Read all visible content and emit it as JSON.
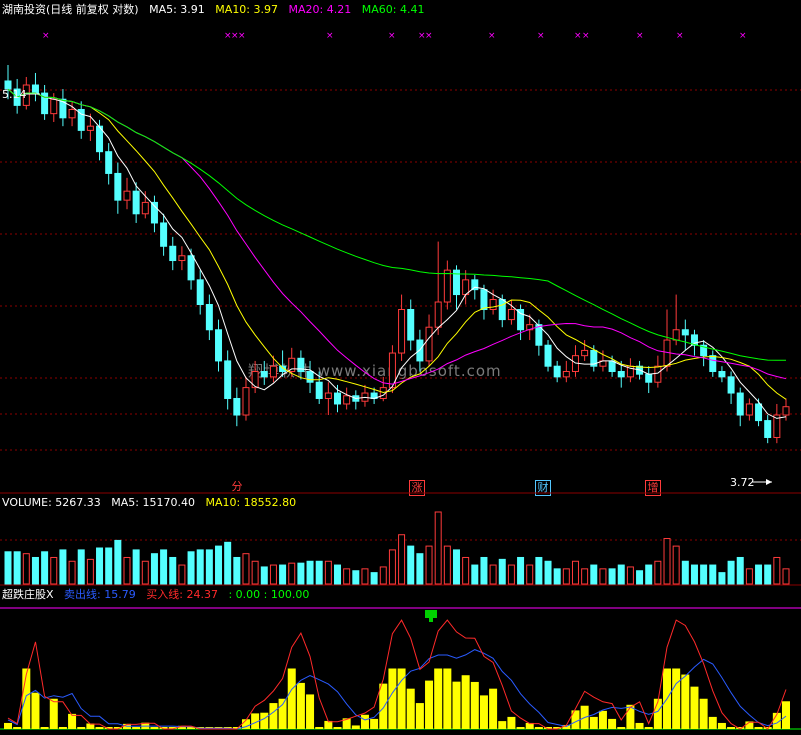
{
  "main_header": {
    "title": "湖南投资(日线 前复权 对数)",
    "ma5": "MA5: 3.91",
    "ma10": "MA10: 3.97",
    "ma20": "MA20: 4.21",
    "ma60": "MA60: 4.41"
  },
  "price_marks": {
    "high_label": "5.14",
    "low_label": "3.72"
  },
  "event_badges": [
    {
      "label": "分",
      "color": "#ff3b3b",
      "x": 236
    },
    {
      "label": "涨",
      "color": "#ff3b3b",
      "x": 409
    },
    {
      "label": "财",
      "color": "#54c7ff",
      "x": 535
    },
    {
      "label": "增",
      "color": "#ff3b3b",
      "x": 645
    }
  ],
  "volume_header": {
    "volume": "VOLUME: 5267.33",
    "ma5": "MA5: 15170.40",
    "ma10": "MA10: 18552.80"
  },
  "indicator_header": {
    "name": "超跌庄股X",
    "sell_line": "卖出线: 15.79",
    "buy_line": "买入线: 24.37",
    "range": ": 0.00 : 100.00"
  },
  "watermark": "翔博软件 www.xiangbosoft.com",
  "colors": {
    "up": "#ff3b3b",
    "down": "#54ffff",
    "ma5": "#ffffff",
    "ma10": "#ffff00",
    "ma20": "#ff00ff",
    "ma60": "#00ff00",
    "grid": "#8b0000",
    "sell_line": "#2a5bff",
    "buy_line": "#ff2a2a",
    "bar_yellow": "#ffff00"
  },
  "chart_data": {
    "type": "candlestick",
    "scale": "log",
    "ylim": [
      3.5,
      5.4
    ],
    "indicator_ylim": [
      0,
      100
    ],
    "candles": [
      [
        5.14,
        5.1,
        5.22,
        5.05
      ],
      [
        5.1,
        5.02,
        5.15,
        4.98
      ],
      [
        5.02,
        5.12,
        5.16,
        5.0
      ],
      [
        5.12,
        5.08,
        5.18,
        5.04
      ],
      [
        5.08,
        4.98,
        5.12,
        4.95
      ],
      [
        4.98,
        5.05,
        5.08,
        4.94
      ],
      [
        5.05,
        4.96,
        5.1,
        4.92
      ],
      [
        4.96,
        5.0,
        5.04,
        4.92
      ],
      [
        5.0,
        4.9,
        5.04,
        4.86
      ],
      [
        4.9,
        4.92,
        4.98,
        4.85
      ],
      [
        4.92,
        4.8,
        4.95,
        4.76
      ],
      [
        4.8,
        4.7,
        4.84,
        4.65
      ],
      [
        4.7,
        4.58,
        4.75,
        4.52
      ],
      [
        4.58,
        4.62,
        4.68,
        4.54
      ],
      [
        4.62,
        4.52,
        4.66,
        4.48
      ],
      [
        4.52,
        4.57,
        4.62,
        4.5
      ],
      [
        4.57,
        4.48,
        4.6,
        4.44
      ],
      [
        4.48,
        4.38,
        4.52,
        4.34
      ],
      [
        4.38,
        4.32,
        4.42,
        4.28
      ],
      [
        4.32,
        4.34,
        4.38,
        4.28
      ],
      [
        4.34,
        4.24,
        4.37,
        4.2
      ],
      [
        4.24,
        4.14,
        4.28,
        4.1
      ],
      [
        4.14,
        4.04,
        4.18,
        4.0
      ],
      [
        4.04,
        3.92,
        4.08,
        3.88
      ],
      [
        3.92,
        3.78,
        3.96,
        3.74
      ],
      [
        3.78,
        3.72,
        3.82,
        3.68
      ],
      [
        3.72,
        3.82,
        3.86,
        3.7
      ],
      [
        3.82,
        3.88,
        3.92,
        3.8
      ],
      [
        3.88,
        3.86,
        3.92,
        3.83
      ],
      [
        3.86,
        3.9,
        3.94,
        3.84
      ],
      [
        3.9,
        3.88,
        3.96,
        3.86
      ],
      [
        3.88,
        3.93,
        3.97,
        3.86
      ],
      [
        3.93,
        3.88,
        3.96,
        3.85
      ],
      [
        3.88,
        3.84,
        3.92,
        3.8
      ],
      [
        3.84,
        3.78,
        3.88,
        3.76
      ],
      [
        3.78,
        3.8,
        3.84,
        3.72
      ],
      [
        3.8,
        3.76,
        3.83,
        3.73
      ],
      [
        3.76,
        3.79,
        3.82,
        3.74
      ],
      [
        3.79,
        3.77,
        3.81,
        3.74
      ],
      [
        3.77,
        3.8,
        3.83,
        3.75
      ],
      [
        3.8,
        3.78,
        3.82,
        3.76
      ],
      [
        3.78,
        3.82,
        3.86,
        3.77
      ],
      [
        3.82,
        3.95,
        3.98,
        3.8
      ],
      [
        3.95,
        4.12,
        4.18,
        3.92
      ],
      [
        4.12,
        4.0,
        4.16,
        3.96
      ],
      [
        4.0,
        3.92,
        4.04,
        3.88
      ],
      [
        3.92,
        4.05,
        4.1,
        3.9
      ],
      [
        4.05,
        4.15,
        4.4,
        4.02
      ],
      [
        4.15,
        4.28,
        4.32,
        4.12
      ],
      [
        4.28,
        4.18,
        4.3,
        4.12
      ],
      [
        4.18,
        4.24,
        4.28,
        4.14
      ],
      [
        4.24,
        4.2,
        4.26,
        4.16
      ],
      [
        4.2,
        4.12,
        4.22,
        4.08
      ],
      [
        4.12,
        4.16,
        4.2,
        4.1
      ],
      [
        4.16,
        4.08,
        4.18,
        4.05
      ],
      [
        4.08,
        4.12,
        4.16,
        4.06
      ],
      [
        4.12,
        4.04,
        4.14,
        4.0
      ],
      [
        4.04,
        4.06,
        4.1,
        4.0
      ],
      [
        4.06,
        3.98,
        4.08,
        3.94
      ],
      [
        3.98,
        3.9,
        4.0,
        3.88
      ],
      [
        3.9,
        3.86,
        3.92,
        3.84
      ],
      [
        3.86,
        3.88,
        3.92,
        3.84
      ],
      [
        3.88,
        3.94,
        3.98,
        3.86
      ],
      [
        3.94,
        3.96,
        4.0,
        3.92
      ],
      [
        3.96,
        3.9,
        3.98,
        3.88
      ],
      [
        3.9,
        3.92,
        3.96,
        3.88
      ],
      [
        3.92,
        3.88,
        3.94,
        3.86
      ],
      [
        3.88,
        3.86,
        3.92,
        3.82
      ],
      [
        3.86,
        3.9,
        3.93,
        3.84
      ],
      [
        3.9,
        3.87,
        3.92,
        3.85
      ],
      [
        3.87,
        3.84,
        3.9,
        3.8
      ],
      [
        3.84,
        3.9,
        3.94,
        3.82
      ],
      [
        3.9,
        4.0,
        4.12,
        3.88
      ],
      [
        4.0,
        4.04,
        4.18,
        3.98
      ],
      [
        4.04,
        4.02,
        4.08,
        3.96
      ],
      [
        4.02,
        3.98,
        4.04,
        3.94
      ],
      [
        3.98,
        3.94,
        4.0,
        3.9
      ],
      [
        3.94,
        3.88,
        3.96,
        3.86
      ],
      [
        3.88,
        3.86,
        3.9,
        3.84
      ],
      [
        3.86,
        3.8,
        3.88,
        3.76
      ],
      [
        3.8,
        3.72,
        3.82,
        3.68
      ],
      [
        3.72,
        3.76,
        3.78,
        3.7
      ],
      [
        3.76,
        3.7,
        3.78,
        3.68
      ],
      [
        3.7,
        3.64,
        3.72,
        3.62
      ],
      [
        3.64,
        3.72,
        3.76,
        3.62
      ],
      [
        3.72,
        3.75,
        3.78,
        3.7
      ]
    ]
  }
}
